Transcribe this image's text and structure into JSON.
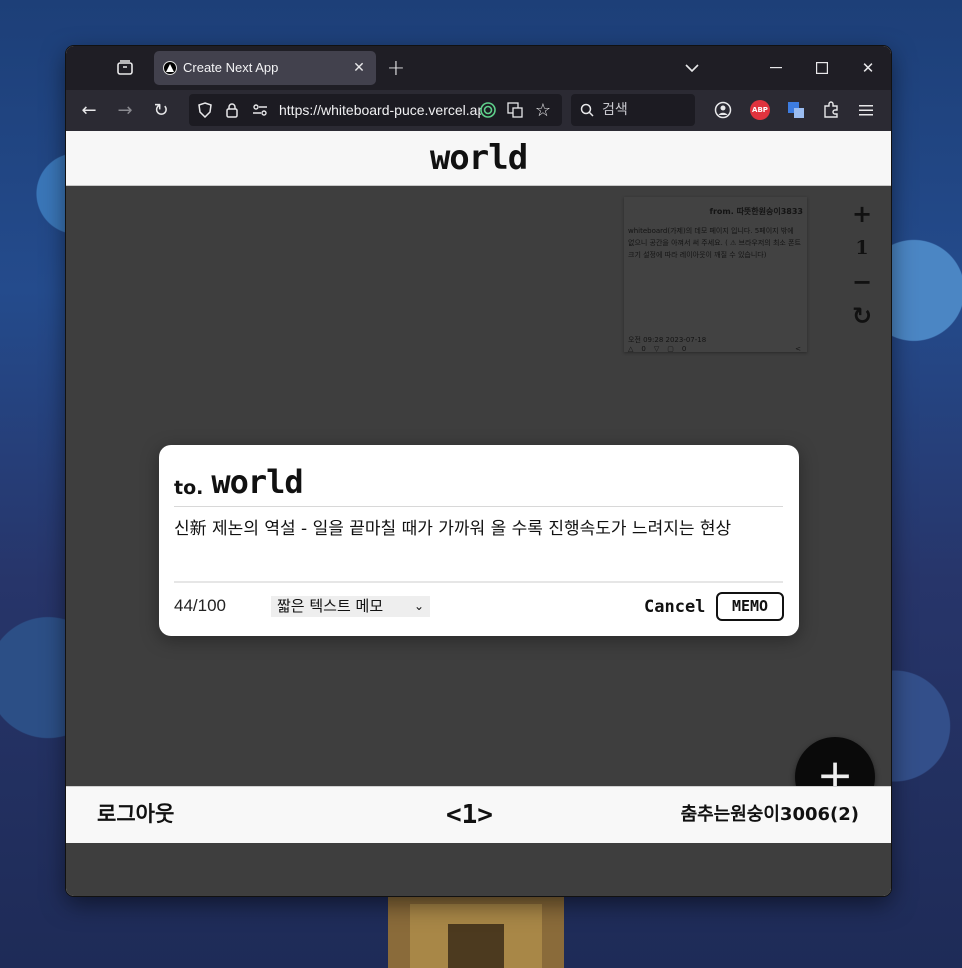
{
  "browser": {
    "tab_title": "Create Next App",
    "url": "https://whiteboard-puce.vercel.app",
    "search_placeholder": "검색",
    "abp_label": "ABP"
  },
  "page": {
    "title": "world",
    "zoom": {
      "plus": "+",
      "level": "1",
      "minus": "−",
      "reset": "↻"
    },
    "memo_card": {
      "from": "from. 따뜻한원숭이3833",
      "body": "whiteboard(가제)의 데모 페이지 입니다. 5페이지 밖에 없으니 공간을 아껴서 써 주세요. ( ⚠ 브라우저의 최소 폰트 크기 설정에 따라 레이아웃이 깨질 수 있습니다)",
      "date": "오전 09:28 2023-07-18",
      "likes": "0",
      "dislikes": "0",
      "comments": "0",
      "share": "<"
    },
    "fab_label": "+"
  },
  "modal": {
    "to_prefix": "to.",
    "to_name": "world",
    "text": "신新 제논의 역설 - 일을 끝마칠 때가 가까워 올 수록 진행속도가 느려지는 현상",
    "count": "44/100",
    "memo_type": "짧은 텍스트 메모",
    "cancel": "Cancel",
    "submit": "MEMO"
  },
  "footer": {
    "logout": "로그아웃",
    "pager": "<1>",
    "user": "춤추는원숭이3006(2)"
  }
}
